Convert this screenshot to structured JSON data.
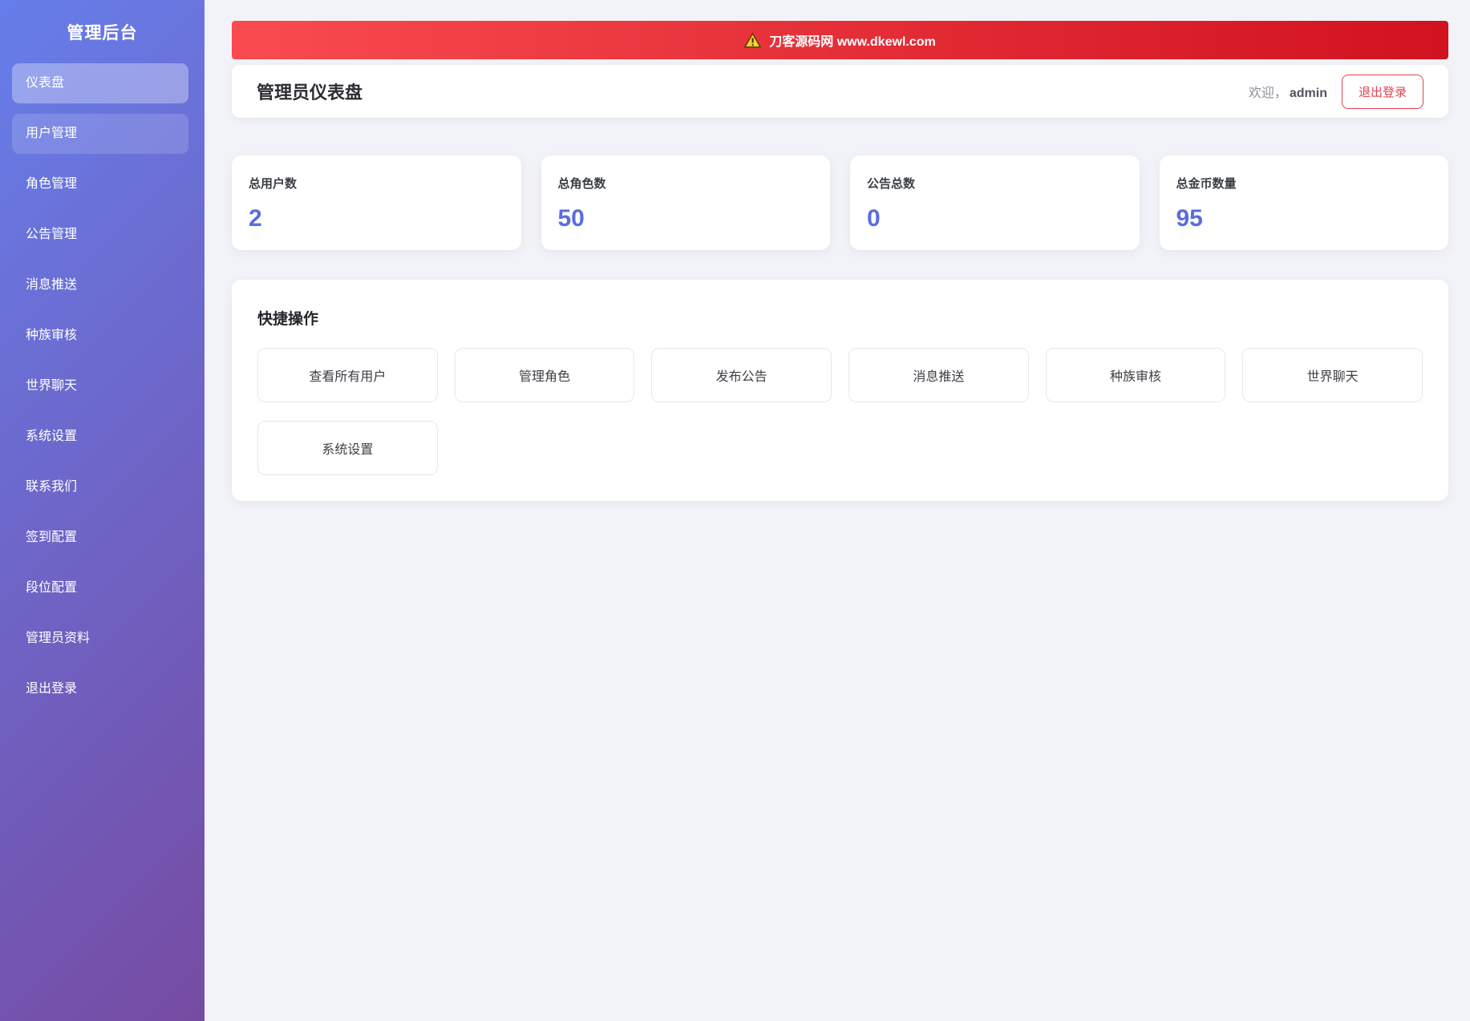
{
  "sidebar": {
    "title": "管理后台",
    "items": [
      {
        "label": "仪表盘",
        "state": "active"
      },
      {
        "label": "用户管理",
        "state": "hover"
      },
      {
        "label": "角色管理",
        "state": ""
      },
      {
        "label": "公告管理",
        "state": ""
      },
      {
        "label": "消息推送",
        "state": ""
      },
      {
        "label": "种族审核",
        "state": ""
      },
      {
        "label": "世界聊天",
        "state": ""
      },
      {
        "label": "系统设置",
        "state": ""
      },
      {
        "label": "联系我们",
        "state": ""
      },
      {
        "label": "签到配置",
        "state": ""
      },
      {
        "label": "段位配置",
        "state": ""
      },
      {
        "label": "管理员资料",
        "state": ""
      },
      {
        "label": "退出登录",
        "state": ""
      }
    ]
  },
  "banner": {
    "icon": "warning-triangle",
    "text": "刀客源码网 www.dkewl.com"
  },
  "header": {
    "title": "管理员仪表盘",
    "welcome_prefix": "欢迎，",
    "username": "admin",
    "logout_label": "退出登录"
  },
  "stats": [
    {
      "label": "总用户数",
      "value": "2"
    },
    {
      "label": "总角色数",
      "value": "50"
    },
    {
      "label": "公告总数",
      "value": "0"
    },
    {
      "label": "总金币数量",
      "value": "95"
    }
  ],
  "quick_actions": {
    "title": "快捷操作",
    "buttons": [
      "查看所有用户",
      "管理角色",
      "发布公告",
      "消息推送",
      "种族审核",
      "世界聊天",
      "系统设置"
    ]
  },
  "colors": {
    "sidebar_gradient_start": "#667eea",
    "sidebar_gradient_end": "#764ba2",
    "banner_gradient_start": "#f94b50",
    "banner_gradient_end": "#d1121f",
    "stat_value_accent": "#5a6ce0",
    "logout_red": "#e0414d",
    "page_background": "#f2f3f8"
  }
}
